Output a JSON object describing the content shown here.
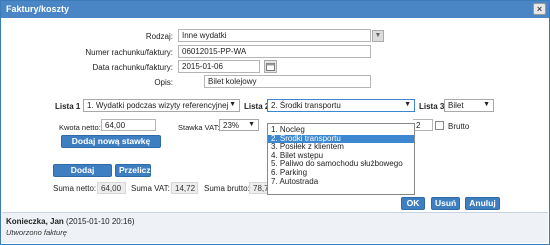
{
  "window": {
    "title": "Faktury/koszty",
    "close_glyph": "×"
  },
  "form": {
    "rodzaj_label": "Rodzaj:",
    "rodzaj_value": "Inne wydatki",
    "numer_label": "Numer rachunku/faktury:",
    "numer_value": "06012015-PP-WA",
    "data_label": "Data rachunku/faktury:",
    "data_value": "2015-01-06",
    "opis_label": "Opis:",
    "opis_value": "Bilet kolejowy"
  },
  "lists": {
    "lista1_label": "Lista 1",
    "lista1_value": "1. Wydatki podczas wizyty referencyjnej",
    "lista2_label": "Lista 2",
    "lista2_value": "2. Środki transportu",
    "lista3_label": "Lista 3",
    "lista3_value": "Bilet",
    "arrow_glyph": "▼"
  },
  "dropdown": {
    "items": [
      "1. Nocleg",
      "2. Środki transportu",
      "3. Posiłek z klientem",
      "4. Bilet wstępu",
      "5. Paliwo do samochodu służbowego",
      "6. Parking",
      "7. Autostrada"
    ],
    "selected_index": 1
  },
  "amounts": {
    "kwota_label": "Kwota netto:",
    "kwota_value": "64,00",
    "vat_label": "Stawka VAT:",
    "vat_value": "23%",
    "partial_value": "2",
    "brutto_label": "Brutto"
  },
  "buttons": {
    "add_vat": "Dodaj nową stawkę VAT",
    "add_item": "Dodaj pozycję",
    "recalc": "Przelicz",
    "ok": "OK",
    "delete": "Usuń",
    "cancel": "Anuluj"
  },
  "sums": {
    "netto_label": "Suma netto:",
    "netto_value": "64,00",
    "vat_label": "Suma VAT:",
    "vat_value": "14,72",
    "brutto_label": "Suma brutto:",
    "brutto_value": "78,7"
  },
  "footer": {
    "author": "Konieczka, Jan",
    "timestamp": "(2015-01-10 20:16)",
    "note": "Utworzono fakturę"
  },
  "colors": {
    "accent": "#4a86c5",
    "button": "#3e7fc2",
    "selected": "#3d86d0"
  }
}
